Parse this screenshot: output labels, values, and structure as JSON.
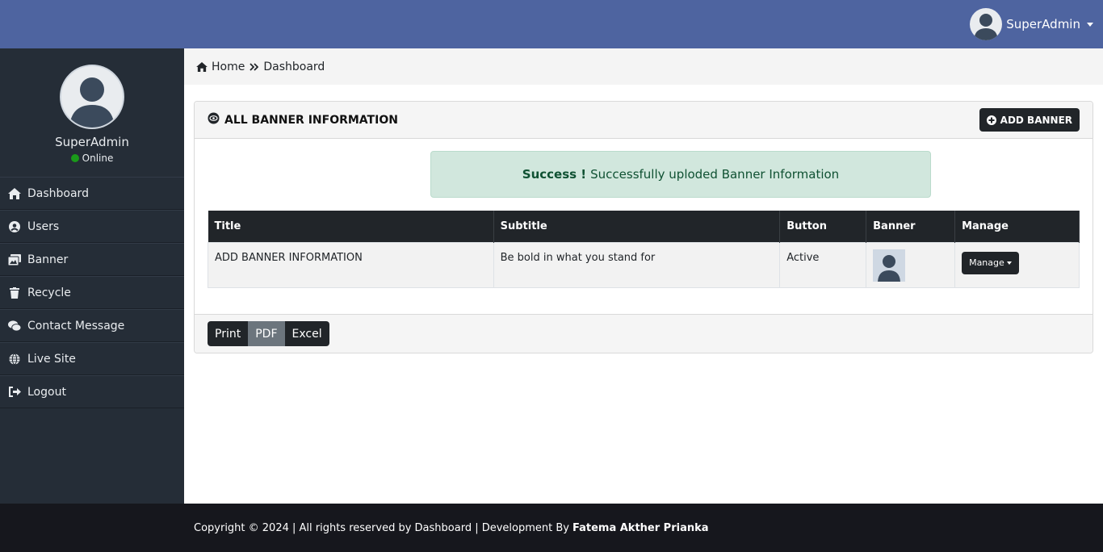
{
  "header": {
    "user_name": "SuperAdmin",
    "avatar_icon": "user-avatar-icon"
  },
  "sidebar": {
    "profile_name": "SuperAdmin",
    "status": "Online",
    "status_color": "#1a9a1a",
    "items": [
      {
        "label": "Dashboard",
        "icon": "home-icon"
      },
      {
        "label": "Users",
        "icon": "user-circle-icon"
      },
      {
        "label": "Banner",
        "icon": "images-icon"
      },
      {
        "label": "Recycle",
        "icon": "trash-icon"
      },
      {
        "label": "Contact Message",
        "icon": "comments-icon"
      },
      {
        "label": "Live Site",
        "icon": "globe-icon"
      },
      {
        "label": "Logout",
        "icon": "sign-out-icon"
      }
    ]
  },
  "breadcrumb": {
    "home": "Home",
    "current": "Dashboard"
  },
  "card": {
    "title": "ALL BANNER INFORMATION",
    "add_button": "ADD BANNER"
  },
  "alert": {
    "strong": "Success !",
    "message": "Successfully uploded Banner Information"
  },
  "table": {
    "headers": [
      "Title",
      "Subtitle",
      "Button",
      "Banner",
      "Manage"
    ],
    "rows": [
      {
        "title": "ADD BANNER INFORMATION",
        "subtitle": "Be bold in what you stand for",
        "button": "Active",
        "banner": "banner-thumbnail",
        "manage": "Manage"
      }
    ]
  },
  "export": {
    "print": "Print",
    "pdf": "PDF",
    "excel": "Excel"
  },
  "footer": {
    "text": "Copyright © 2024 | All rights reserved by Dashboard | Development By",
    "author": "Fatema Akther Prianka"
  },
  "colors": {
    "topbar": "#4e64a0",
    "sidebar": "#252d37",
    "dark": "#212529",
    "success_bg": "#d1e7dd"
  }
}
